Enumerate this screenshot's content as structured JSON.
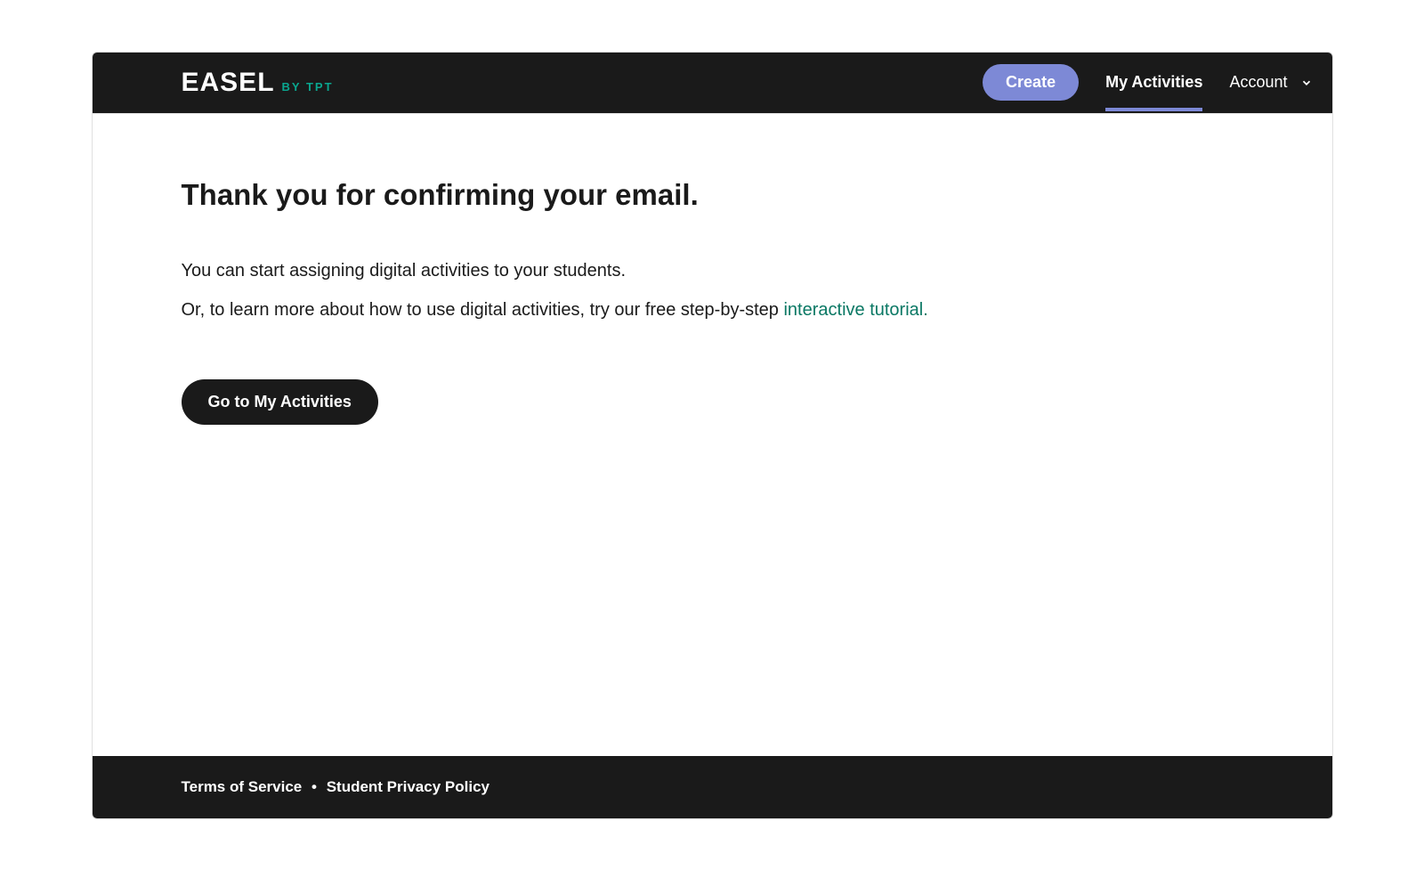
{
  "header": {
    "logo_main": "EASEL",
    "logo_sub": "BY TPT",
    "create_button": "Create",
    "nav_activities": "My Activities",
    "nav_account": "Account"
  },
  "main": {
    "heading": "Thank you for confirming your email.",
    "body_line1": "You can start assigning digital activities to your students.",
    "body_line2_prefix": "Or, to learn more about how to use digital activities, try our free step-by-step ",
    "tutorial_link_text": "interactive tutorial.",
    "primary_button": "Go to My Activities"
  },
  "footer": {
    "terms_link": "Terms of Service",
    "separator": "•",
    "privacy_link": "Student Privacy Policy"
  }
}
